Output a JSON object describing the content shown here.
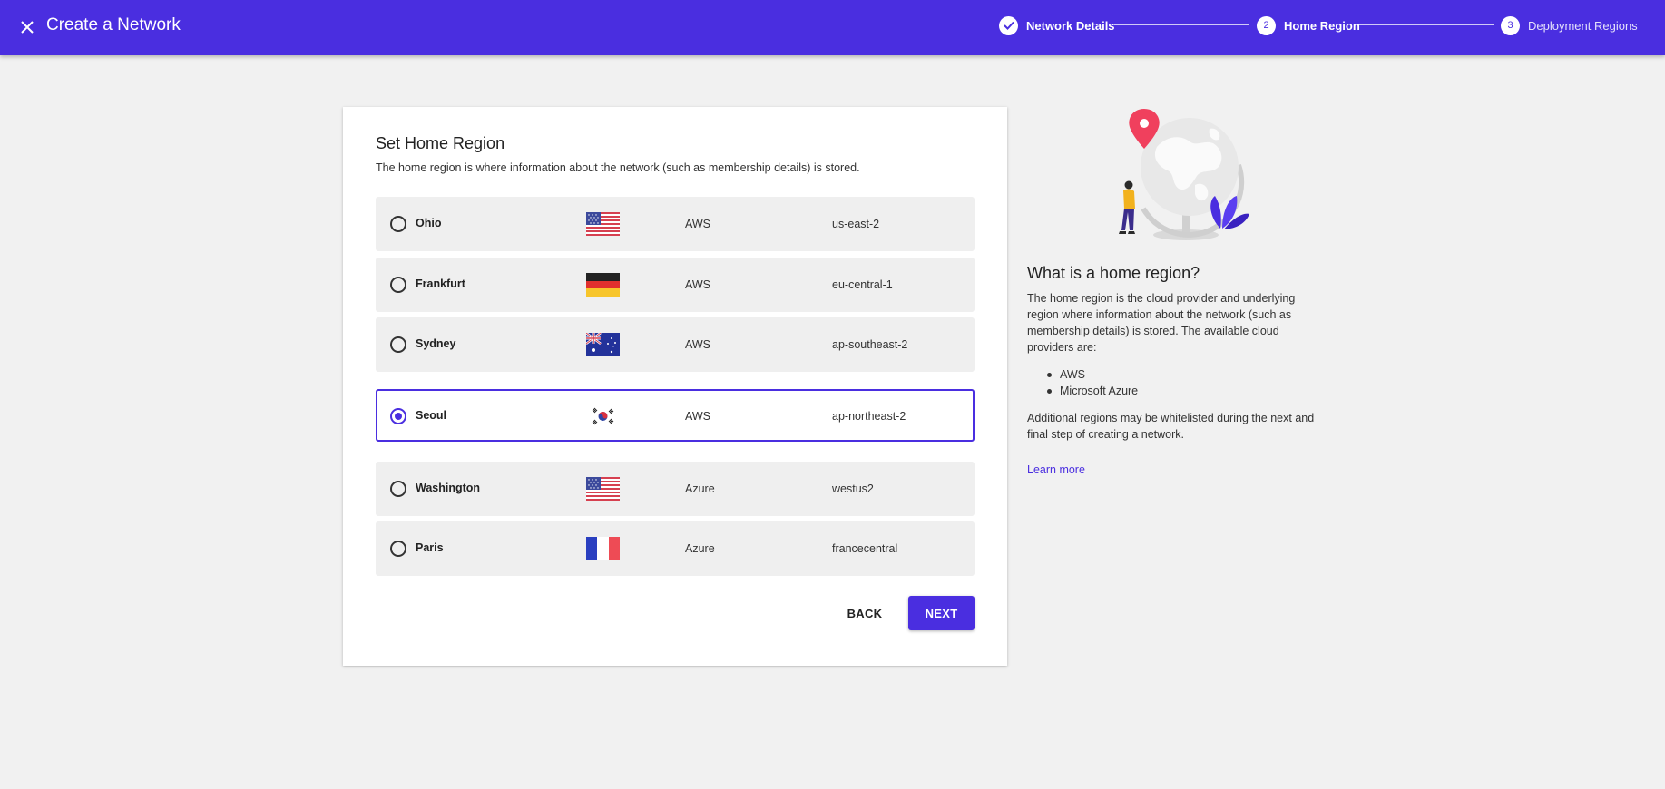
{
  "header": {
    "title": "Create a Network",
    "close_icon": "close-icon",
    "steps": [
      {
        "number": "",
        "label": "Network Details",
        "state": "completed",
        "icon": "check-icon"
      },
      {
        "number": "2",
        "label": "Home Region",
        "state": "active"
      },
      {
        "number": "3",
        "label": "Deployment Regions",
        "state": "upcoming"
      }
    ]
  },
  "card": {
    "title": "Set Home Region",
    "description": "The home region is where information about the network (such as membership details) is stored.",
    "regions": [
      {
        "name": "Ohio",
        "flag": "flag-us-icon",
        "provider": "AWS",
        "code": "us-east-2",
        "selected": false
      },
      {
        "name": "Frankfurt",
        "flag": "flag-de-icon",
        "provider": "AWS",
        "code": "eu-central-1",
        "selected": false
      },
      {
        "name": "Sydney",
        "flag": "flag-au-icon",
        "provider": "AWS",
        "code": "ap-southeast-2",
        "selected": false
      },
      {
        "name": "Seoul",
        "flag": "flag-kr-icon",
        "provider": "AWS",
        "code": "ap-northeast-2",
        "selected": true
      },
      {
        "name": "Washington",
        "flag": "flag-us-icon",
        "provider": "Azure",
        "code": "westus2",
        "selected": false
      },
      {
        "name": "Paris",
        "flag": "flag-fr-icon",
        "provider": "Azure",
        "code": "francecentral",
        "selected": false
      }
    ],
    "back_label": "BACK",
    "next_label": "NEXT"
  },
  "info": {
    "illustration": "globe-illustration",
    "title": "What is a home region?",
    "text": "The home region is the cloud provider and underlying region where information about the network (such as membership details) is stored. The available cloud providers are:",
    "providers": [
      "AWS",
      "Microsoft Azure"
    ],
    "text2": "Additional regions may be whitelisted during the next and final step of creating a network.",
    "learn_more": "Learn more"
  },
  "colors": {
    "primary": "#4a2ee0",
    "background": "#f1f1f1",
    "row_background": "#efefef"
  }
}
